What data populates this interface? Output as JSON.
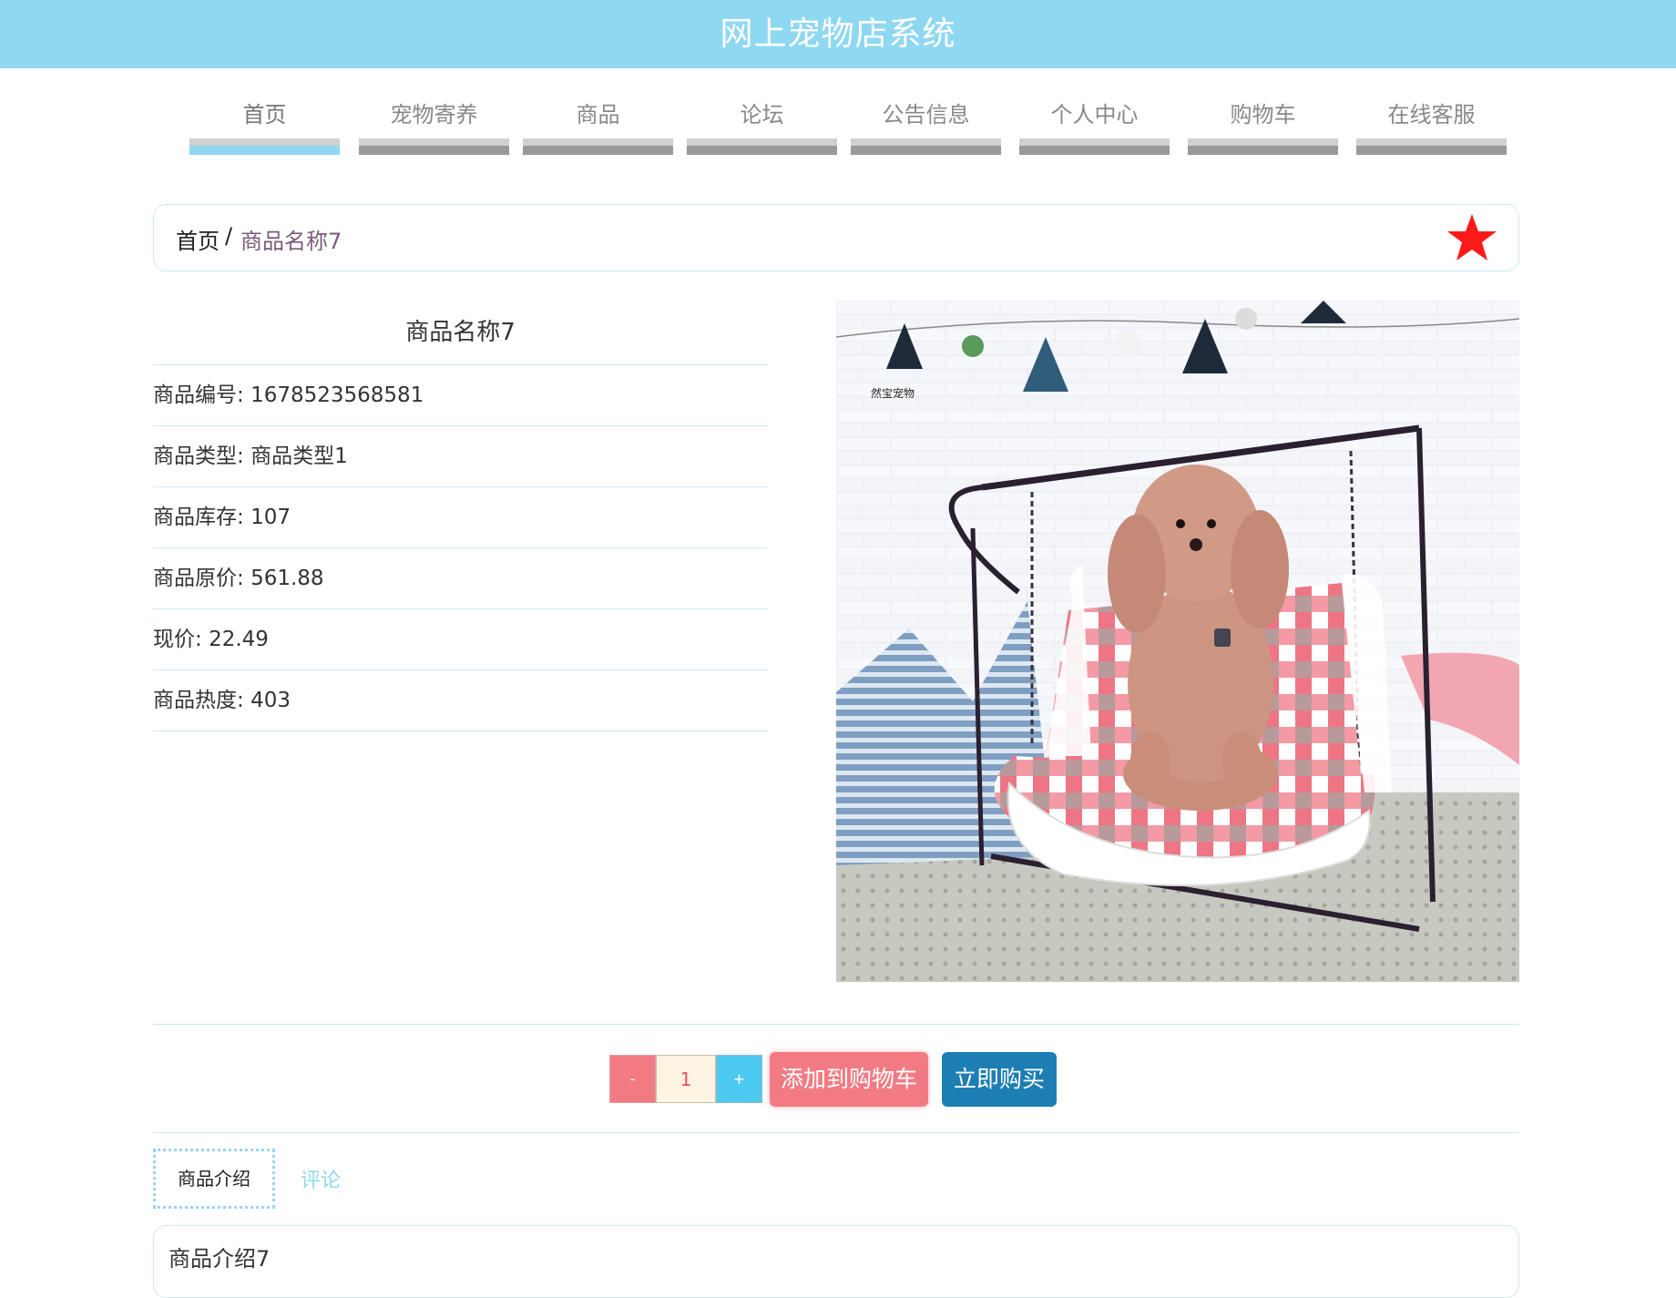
{
  "app": {
    "title": "网上宠物店系统",
    "header_color": "#8fd8f2"
  },
  "nav": {
    "active_index": 0,
    "items": [
      {
        "label": "首页"
      },
      {
        "label": "宠物寄养"
      },
      {
        "label": "商品"
      },
      {
        "label": "论坛"
      },
      {
        "label": "公告信息"
      },
      {
        "label": "个人中心"
      },
      {
        "label": "购物车"
      },
      {
        "label": "在线客服"
      }
    ]
  },
  "breadcrumb": {
    "home": "首页",
    "separator": "/",
    "current": "商品名称7",
    "favorite_icon": "star-icon",
    "favorite_color": "#ff1a1a"
  },
  "product": {
    "name": "商品名称7",
    "fields": [
      {
        "label": "商品编号",
        "value": "1678523568581"
      },
      {
        "label": "商品类型",
        "value": "商品类型1"
      },
      {
        "label": "商品库存",
        "value": "107"
      },
      {
        "label": "商品原价",
        "value": "561.88"
      },
      {
        "label": "现价",
        "value": "22.49"
      },
      {
        "label": "商品热度",
        "value": "403"
      }
    ],
    "image_watermark": "然宝宠物"
  },
  "purchase": {
    "minus": "-",
    "quantity": "1",
    "plus": "+",
    "add_to_cart": "添加到购物车",
    "buy_now": "立即购买"
  },
  "tabs": {
    "intro": "商品介绍",
    "comments": "评论"
  },
  "intro": {
    "text": "商品介绍7"
  }
}
